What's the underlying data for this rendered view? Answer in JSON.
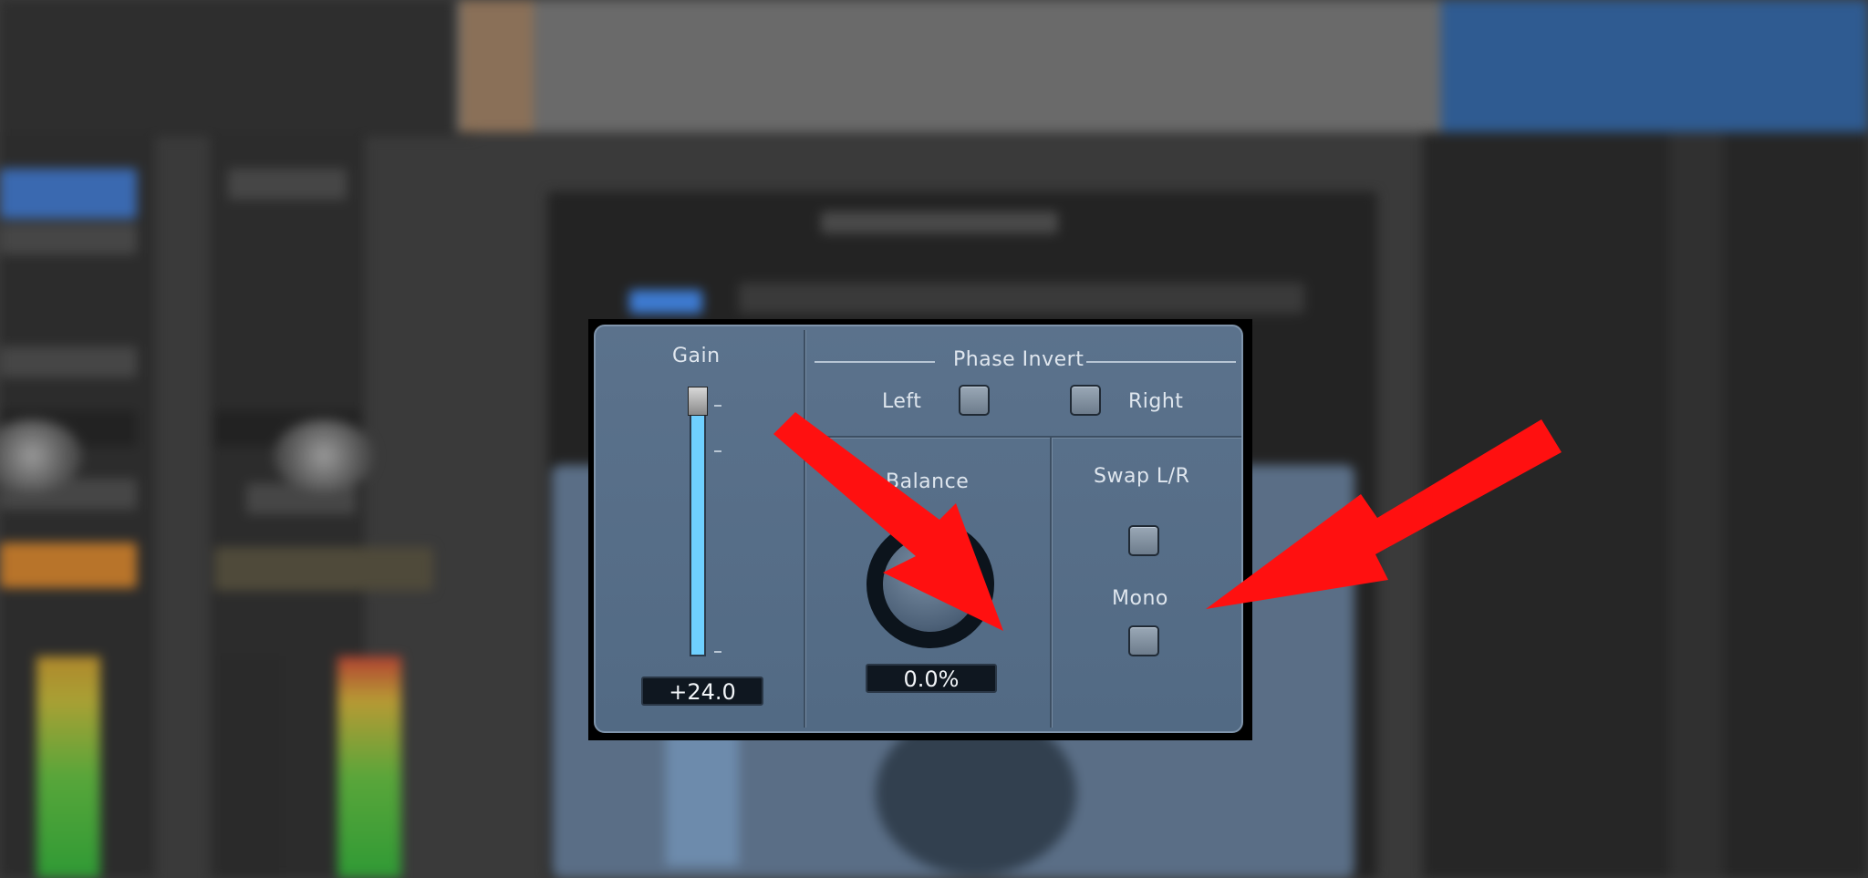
{
  "plugin": {
    "gain": {
      "label": "Gain",
      "value": "+24.0",
      "level": 1.0
    },
    "phase_invert": {
      "label": "Phase Invert",
      "left_label": "Left",
      "right_label": "Right"
    },
    "balance": {
      "label": "Balance",
      "value": "0.0%"
    },
    "swap": {
      "label": "Swap L/R"
    },
    "mono": {
      "label": "Mono"
    }
  },
  "colors": {
    "panel": "#5b728c",
    "gain_fill": "#6fd0ff",
    "arrow": "#ff1010"
  }
}
